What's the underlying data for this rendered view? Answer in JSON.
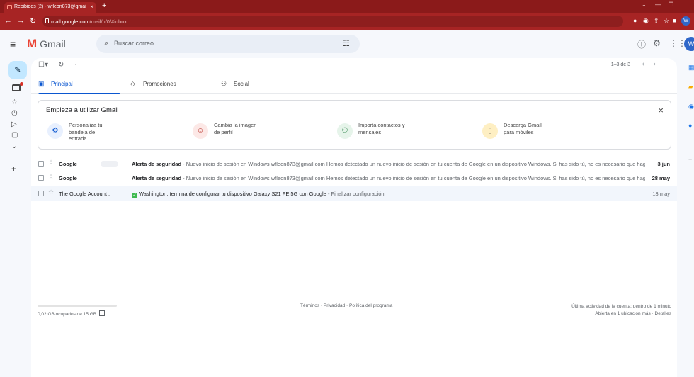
{
  "browser": {
    "tab_title": "Recibidos (2) - wfleon873@gmai",
    "tab_close": "×",
    "new_tab": "+",
    "url_host": "mail.google.com",
    "url_path": "/mail/u/0/#inbox",
    "profile_initial": "W"
  },
  "header": {
    "app_name": "Gmail",
    "search_placeholder": "Buscar correo",
    "avatar_initial": "W"
  },
  "toolbar": {
    "pager": "1–3 de 3"
  },
  "tabs": [
    {
      "label": "Principal",
      "active": true
    },
    {
      "label": "Promociones",
      "active": false
    },
    {
      "label": "Social",
      "active": false
    }
  ],
  "setup": {
    "title": "Empieza a utilizar Gmail",
    "steps": [
      {
        "text": "Personaliza tu bandeja de entrada",
        "icon": "gear-icon",
        "color": "#e8f0fe"
      },
      {
        "text": "Cambia la imagen de perfil",
        "icon": "account-icon",
        "color": "#fce8e6"
      },
      {
        "text": "Importa contactos y mensajes",
        "icon": "add-person-icon",
        "color": "#e6f4ea"
      },
      {
        "text": "Descarga Gmail para móviles",
        "icon": "phone-icon",
        "color": "#feefc3"
      }
    ]
  },
  "emails": [
    {
      "from": "Google",
      "subject": "Alerta de seguridad",
      "snippet": " - Nuevo inicio de sesión en Windows wfleon873@gmail.com Hemos detectado un nuevo inicio de sesión en tu cuenta de Google en un dispositivo Windows. Si has sido tú, no es necesario que haga...",
      "date": "3 jun",
      "unread": true
    },
    {
      "from": "Google",
      "subject": "Alerta de seguridad",
      "snippet": " - Nuevo inicio de sesión en Windows wfleon873@gmail.com Hemos detectado un nuevo inicio de sesión en tu cuenta de Google en un dispositivo Windows. Si has sido tú, no es necesario que haga...",
      "date": "28 may",
      "unread": true
    },
    {
      "from": "The Google Account .",
      "subject": "Washington, termina de configurar tu dispositivo Galaxy S21 FE 5G con Google",
      "snippet": " - Finalizar configuración",
      "date": "13 may",
      "unread": false
    }
  ],
  "footer": {
    "storage": "0,02 GB ocupados de 15 GB",
    "links": "Términos · Privacidad · Política del programa",
    "activity": "Última actividad de la cuenta: dentro de 1 minuto",
    "details": "Abierta en 1 ubicación más · Detalles"
  },
  "colors": {
    "accent": "#0b57d0",
    "browser_frame": "#a72424",
    "compose": "#c2e7ff"
  }
}
